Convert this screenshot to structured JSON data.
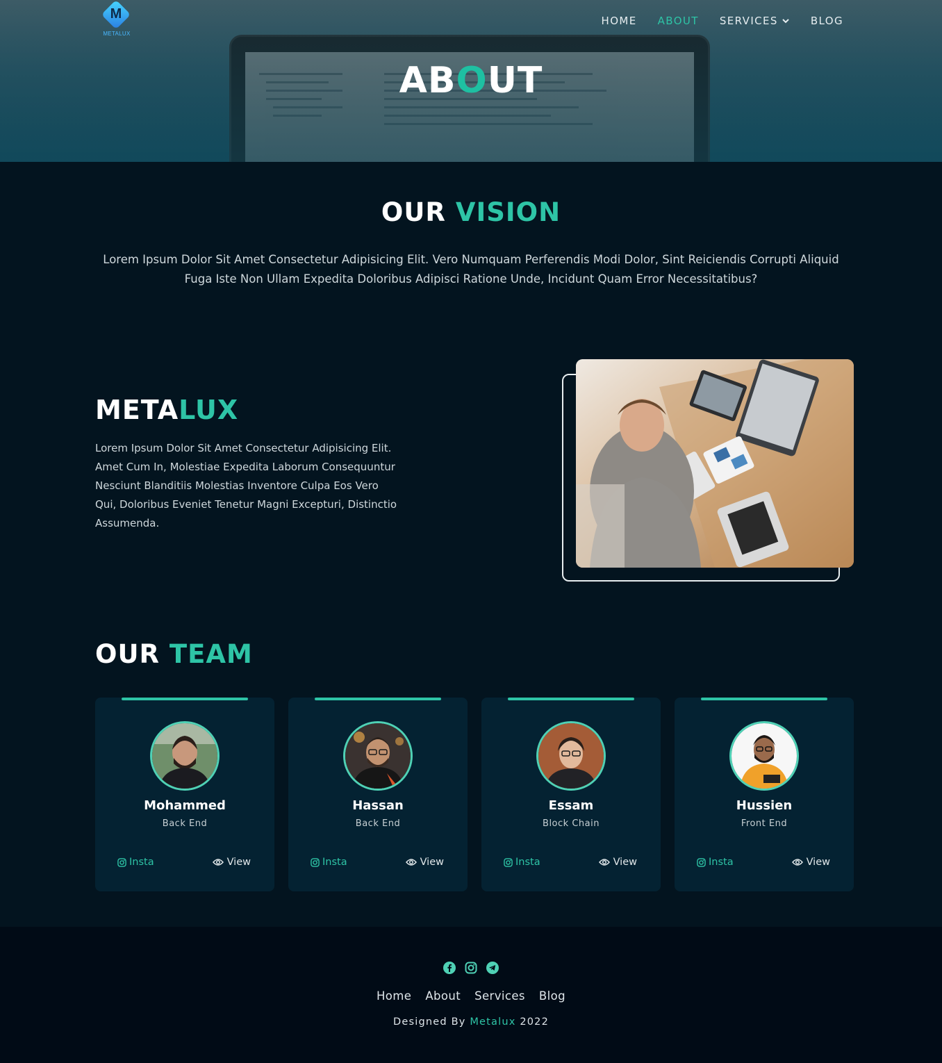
{
  "brand": {
    "logo_letter": "M",
    "logo_text": "METALUX"
  },
  "nav": {
    "items": [
      {
        "label": "HOME"
      },
      {
        "label": "ABOUT"
      },
      {
        "label": "SERVICES"
      },
      {
        "label": "BLOG"
      }
    ],
    "active": "ABOUT"
  },
  "hero": {
    "title_part1": "AB",
    "title_accent": "O",
    "title_part2": "UT"
  },
  "vision": {
    "title_white": "OUR",
    "title_accent": "VISION",
    "text": "Lorem Ipsum Dolor Sit Amet Consectetur Adipisicing Elit. Vero Numquam Perferendis Modi Dolor, Sint Reiciendis Corrupti Aliquid Fuga Iste Non Ullam Expedita Doloribus Adipisci Ratione Unde, Incidunt Quam Error Necessitatibus?"
  },
  "metalux": {
    "title_white": "META",
    "title_accent": "LUX",
    "text": "Lorem Ipsum Dolor Sit Amet Consectetur Adipisicing Elit. Amet Cum In, Molestiae Expedita Laborum Consequuntur Nesciunt Blanditiis Molestias Inventore Culpa Eos Vero Qui, Doloribus Eveniet Tenetur Magni Excepturi, Distinctio Assumenda."
  },
  "team": {
    "title_white": "OUR",
    "title_accent": "TEAM",
    "insta_label": "Insta",
    "view_label": "View",
    "members": [
      {
        "name": "Mohammed",
        "role": "Back End"
      },
      {
        "name": "Hassan",
        "role": "Back End"
      },
      {
        "name": "Essam",
        "role": "Block Chain"
      },
      {
        "name": "Hussien",
        "role": "Front End"
      }
    ]
  },
  "footer": {
    "links": [
      {
        "label": "Home"
      },
      {
        "label": "About"
      },
      {
        "label": "Services"
      },
      {
        "label": "Blog"
      }
    ],
    "social_icons": [
      "facebook-icon",
      "instagram-icon",
      "telegram-icon"
    ],
    "credit_prefix": "Designed By",
    "credit_brand": "Metalux",
    "credit_year": "2022"
  },
  "colors": {
    "accent": "#2ec4a6",
    "background": "#03141f",
    "card": "#042232",
    "footer": "#010b16"
  }
}
